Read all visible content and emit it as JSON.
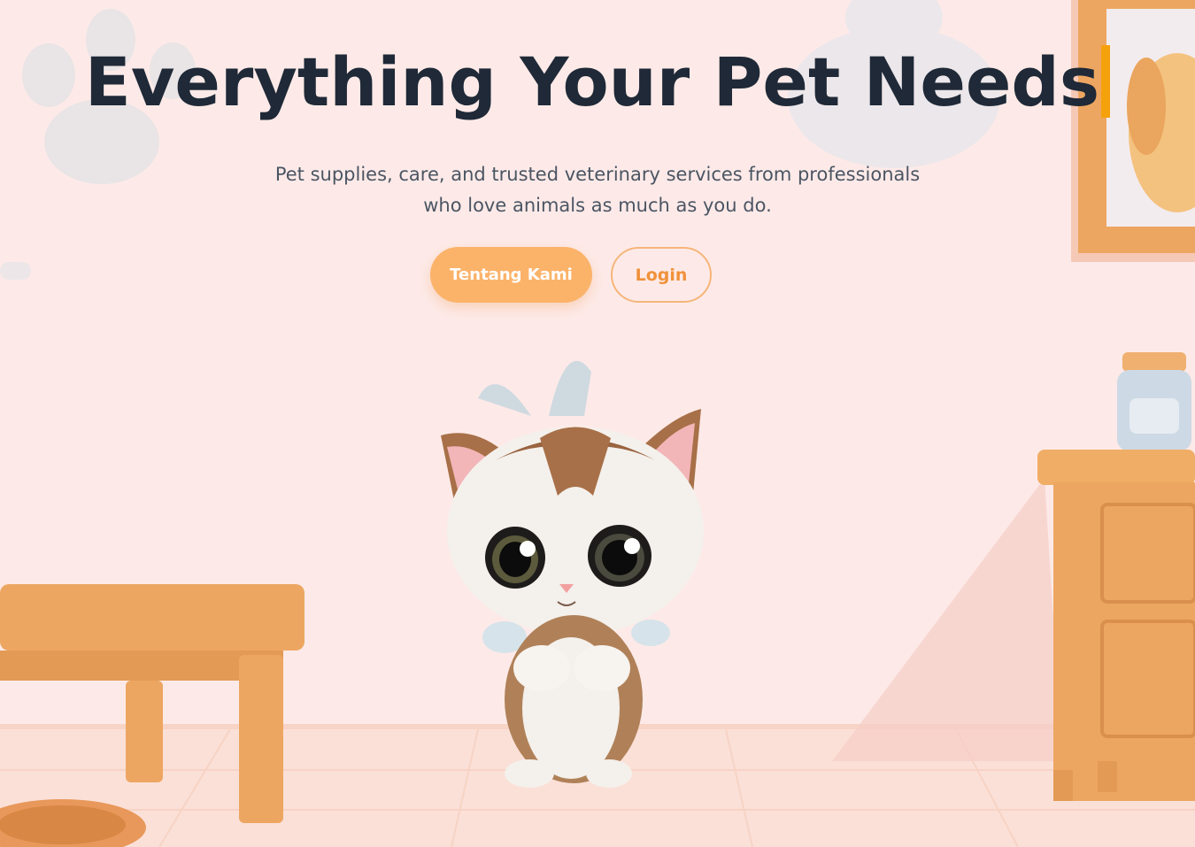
{
  "hero": {
    "headline": "Everything Your Pet Needs",
    "subtitle_line1": "Pet supplies, care, and trusted veterinary services from professionals",
    "subtitle_line2": "who love animals as much as you do."
  },
  "buttons": {
    "primary_label": "Tentang Kami",
    "secondary_label": "Login"
  },
  "colors": {
    "background": "#fdeae8",
    "headline": "#1f2937",
    "caret": "#f5a10c",
    "primary_button": "#fbb36a",
    "outline_button": "#f0913a",
    "furniture": "#eda661"
  }
}
